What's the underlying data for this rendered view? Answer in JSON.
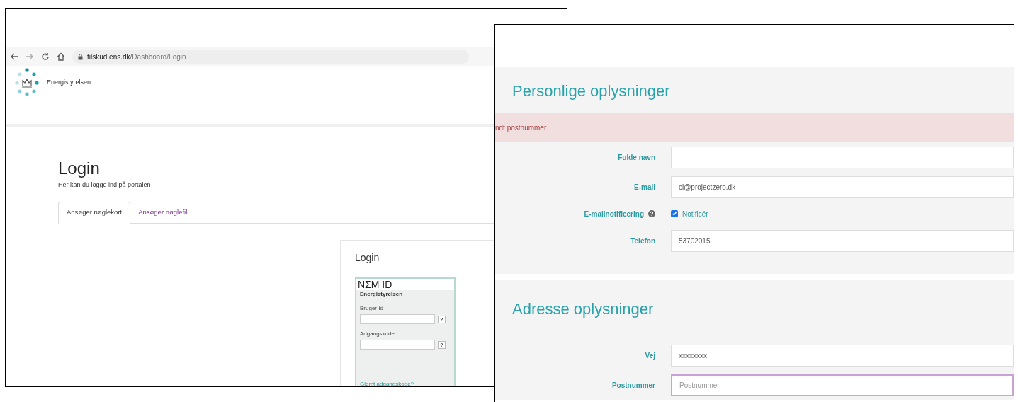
{
  "login_window": {
    "address_bar": {
      "host": "tilskud.ens.dk",
      "path": "/Dashboard/Login"
    },
    "logo_text": "Energistyrelsen",
    "page_title": "Login",
    "subtitle": "Her kan du logge ind på portalen",
    "tabs": [
      {
        "label": "Ansøger nøglekort",
        "selected": true
      },
      {
        "label": "Ansøger nøglefil",
        "selected": false
      }
    ],
    "card_title": "Login",
    "nemid": {
      "logo": "NΣM ID",
      "org": "Energistyrelsen",
      "fields": [
        {
          "label": "Bruger-id",
          "help": "?"
        },
        {
          "label": "Adgangskode",
          "help": "?"
        }
      ],
      "forgot_link": "Glemt adgangskode?"
    }
  },
  "form_window": {
    "sections": [
      {
        "title": "Personlige oplysninger",
        "error": "ndt postnummer",
        "rows": [
          {
            "kind": "input",
            "label": "Fulde navn",
            "focused": false
          },
          {
            "kind": "input",
            "label": "E-mail",
            "value": "cl@projectzero.dk",
            "focused": false
          },
          {
            "kind": "checkbox",
            "label": "E-mailnotificering",
            "option": "Notificér",
            "checked": true
          },
          {
            "kind": "input",
            "label": "Telefon",
            "value": "53702015",
            "focused": false
          }
        ]
      },
      {
        "title": "Adresse oplysninger",
        "rows": [
          {
            "kind": "input",
            "label": "Vej",
            "value": "xxxxxxxx",
            "focused": false
          },
          {
            "kind": "input",
            "label": "Postnummer",
            "placeholder": "Postnummer",
            "focused": true
          }
        ]
      }
    ]
  }
}
